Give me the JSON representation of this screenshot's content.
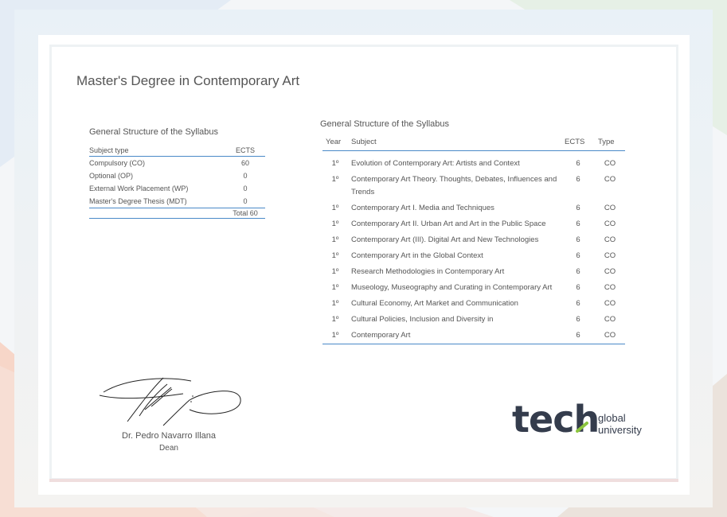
{
  "title": "Master's Degree in Contemporary Art",
  "left_table": {
    "heading": "General Structure of the Syllabus",
    "col_subject_type": "Subject type",
    "col_ects": "ECTS",
    "rows": [
      {
        "label": "Compulsory (CO)",
        "ects": "60"
      },
      {
        "label": "Optional (OP)",
        "ects": "0"
      },
      {
        "label": "External Work Placement (WP)",
        "ects": "0"
      },
      {
        "label": "Master's Degree Thesis (MDT)",
        "ects": "0"
      }
    ],
    "total": "Total 60"
  },
  "right_table": {
    "heading": "General Structure of the Syllabus",
    "col_year": "Year",
    "col_subject": "Subject",
    "col_ects": "ECTS",
    "col_type": "Type",
    "rows": [
      {
        "year": "1º",
        "subject": "Evolution of Contemporary Art: Artists and Context",
        "ects": "6",
        "type": "CO"
      },
      {
        "year": "1º",
        "subject": "Contemporary Art Theory. Thoughts, Debates, Influences and Trends",
        "ects": "6",
        "type": "CO"
      },
      {
        "year": "1º",
        "subject": "Contemporary Art I. Media and Techniques",
        "ects": "6",
        "type": "CO"
      },
      {
        "year": "1º",
        "subject": "Contemporary Art II. Urban Art and Art in the Public Space",
        "ects": "6",
        "type": "CO"
      },
      {
        "year": "1º",
        "subject": "Contemporary Art (III). Digital Art and New Technologies",
        "ects": "6",
        "type": "CO"
      },
      {
        "year": "1º",
        "subject": "Contemporary Art in the Global Context",
        "ects": "6",
        "type": "CO"
      },
      {
        "year": "1º",
        "subject": "Research Methodologies in Contemporary Art",
        "ects": "6",
        "type": "CO"
      },
      {
        "year": "1º",
        "subject": "Museology, Museography and Curating in Contemporary Art",
        "ects": "6",
        "type": "CO"
      },
      {
        "year": "1º",
        "subject": "Cultural Economy, Art Market and Communication",
        "ects": "6",
        "type": "CO"
      },
      {
        "year": "1º",
        "subject": "Cultural Policies, Inclusion and Diversity in",
        "ects": "6",
        "type": "CO"
      },
      {
        "year": "1º",
        "subject": "Contemporary Art",
        "ects": "6",
        "type": "CO"
      }
    ]
  },
  "signatory": {
    "name": "Dr. Pedro Navarro Illana",
    "role": "Dean"
  },
  "logo": {
    "word": "tech",
    "sub1": "global",
    "sub2": "university",
    "colors": {
      "dark": "#343c4c",
      "accent_green": "#8cc63e",
      "accent_blue": "#2aa3d8"
    }
  }
}
